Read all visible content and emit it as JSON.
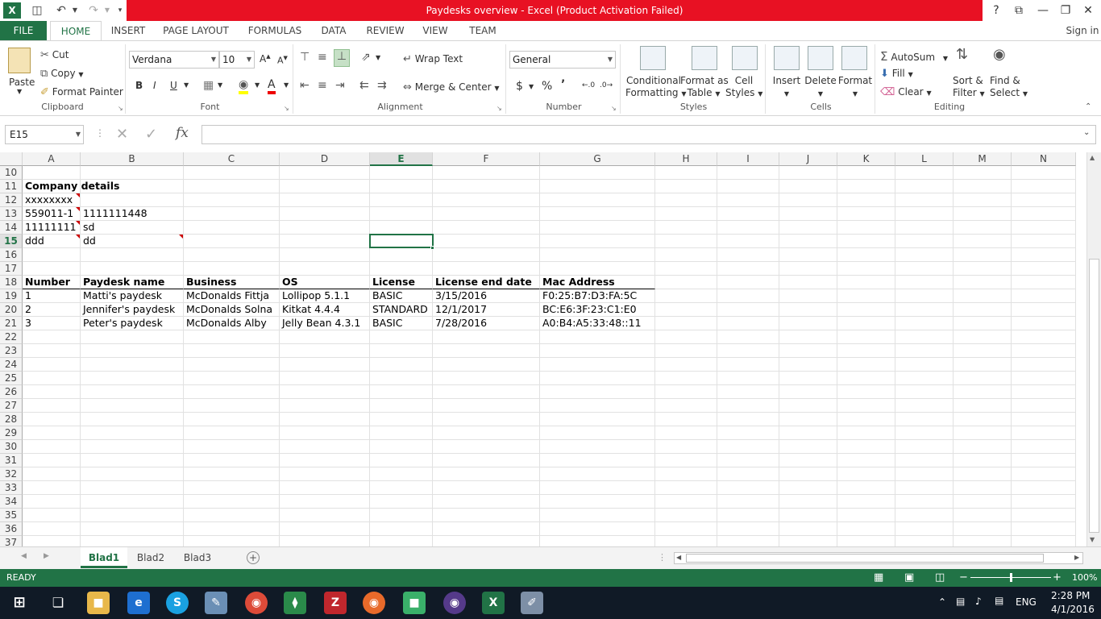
{
  "window": {
    "title": "Paydesks overview -  Excel (Product Activation Failed)",
    "help": "?",
    "ribbon_display": "⧉",
    "minimize": "—",
    "restore": "❐",
    "close": "✕"
  },
  "quick_access": {
    "save": "💾",
    "undo": "↶",
    "redo": "↷"
  },
  "tabs": [
    "FILE",
    "HOME",
    "INSERT",
    "PAGE LAYOUT",
    "FORMULAS",
    "DATA",
    "REVIEW",
    "VIEW",
    "TEAM"
  ],
  "sign_in": "Sign in",
  "clipboard": {
    "paste": "Paste",
    "cut": "Cut",
    "copy": "Copy",
    "format_painter": "Format Painter",
    "label": "Clipboard"
  },
  "font": {
    "name": "Verdana",
    "size": "10",
    "bold": "B",
    "italic": "I",
    "underline": "U",
    "label": "Font"
  },
  "alignment": {
    "wrap": "Wrap Text",
    "merge": "Merge & Center",
    "label": "Alignment"
  },
  "number": {
    "format": "General",
    "currency": "$",
    "percent": "%",
    "comma": "’",
    "label": "Number"
  },
  "styles": {
    "conditional": [
      "Conditional",
      "Formatting"
    ],
    "format_table": [
      "Format as",
      "Table"
    ],
    "cell_styles": [
      "Cell",
      "Styles"
    ],
    "label": "Styles"
  },
  "cells": {
    "insert": "Insert",
    "delete": "Delete",
    "format": "Format",
    "label": "Cells"
  },
  "editing": {
    "autosum": "AutoSum",
    "fill": "Fill",
    "clear": "Clear",
    "sort": [
      "Sort &",
      "Filter"
    ],
    "find": [
      "Find &",
      "Select"
    ],
    "label": "Editing"
  },
  "formula_bar": {
    "name_box": "E15",
    "fx": "fx",
    "value": ""
  },
  "columns": [
    "A",
    "B",
    "C",
    "D",
    "E",
    "F",
    "G",
    "H",
    "I",
    "J",
    "K",
    "L",
    "M",
    "N"
  ],
  "selected_column": "E",
  "selected_row": 15,
  "rows": [
    10,
    11,
    12,
    13,
    14,
    15,
    16,
    17,
    18,
    19,
    20,
    21,
    22,
    23,
    24,
    25,
    26,
    27,
    28,
    29,
    30,
    31,
    32,
    33,
    34,
    35,
    36,
    37
  ],
  "cells_data": {
    "company_title": "Company details",
    "r12a": "xxxxxxxx",
    "r13a": "559011-1",
    "r13b": "1111111448",
    "r14a": "11111111",
    "r14b": "sd",
    "r15a": "ddd",
    "r15b": "dd"
  },
  "table": {
    "headers": [
      "Number",
      "Paydesk name",
      "Business",
      "OS",
      "License",
      "License end date",
      "Mac Address"
    ],
    "rows": [
      [
        "1",
        "Matti's paydesk",
        "McDonalds Fittja",
        "Lollipop 5.1.1",
        "BASIC",
        "3/15/2016",
        "F0:25:B7:D3:FA:5C"
      ],
      [
        "2",
        "Jennifer's paydesk",
        "McDonalds Solna",
        "Kitkat 4.4.4",
        "STANDARD",
        "12/1/2017",
        "BC:E6:3F:23:C1:E0"
      ],
      [
        "3",
        "Peter's paydesk",
        "McDonalds Alby",
        "Jelly Bean 4.3.1",
        "BASIC",
        "7/28/2016",
        "A0:B4:A5:33:48::11"
      ]
    ]
  },
  "sheets": [
    "Blad1",
    "Blad2",
    "Blad3"
  ],
  "add_sheet": "+",
  "status": {
    "text": "READY",
    "zoom": "100%",
    "zoom_level": 0.5
  },
  "taskbar": {
    "time": "2:28 PM",
    "date": "4/1/2016",
    "lang": "ENG"
  },
  "colors": {
    "excel_green": "#217346",
    "title_red": "#e81123",
    "taskbar": "#101a26"
  }
}
